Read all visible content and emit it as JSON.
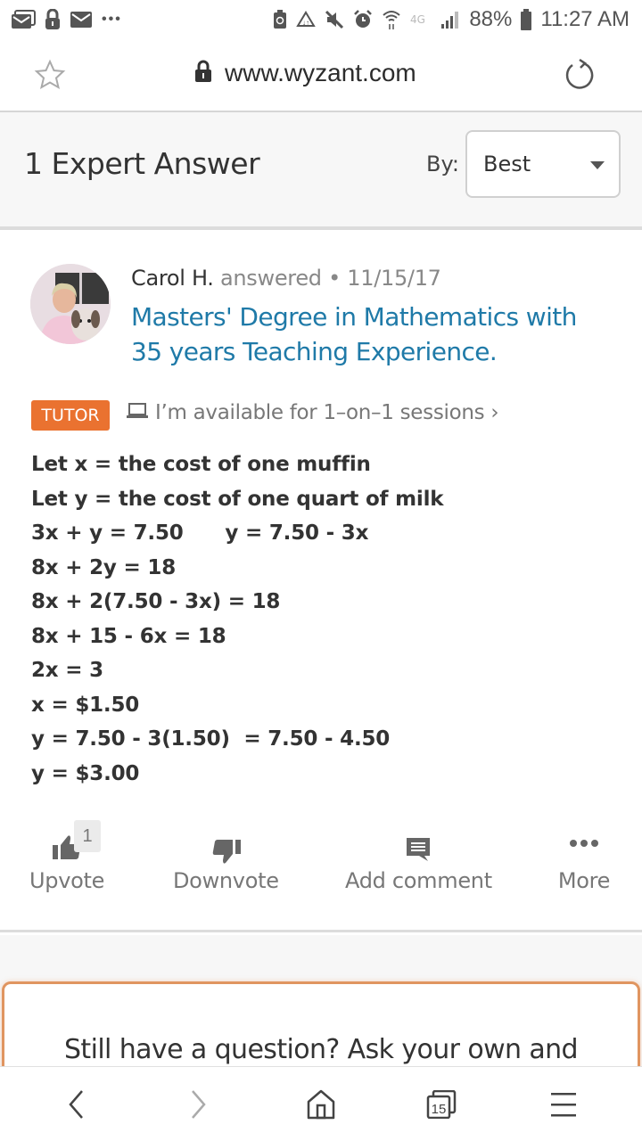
{
  "status_bar": {
    "left_icons": [
      "email-stack-icon",
      "lock-icon",
      "email-icon",
      "more-notifications-icon"
    ],
    "right_icons": [
      "battery-saver-icon",
      "recycle-icon",
      "mute-icon",
      "alarm-icon",
      "wifi-icon",
      "lte-icon",
      "signal-icon"
    ],
    "battery": "88%",
    "time": "11:27 AM"
  },
  "browser": {
    "url": "www.wyzant.com",
    "bookmark_icon": "star-icon",
    "secure_icon": "lock-icon",
    "reload_icon": "reload-icon"
  },
  "answers_header": {
    "title": "1 Expert Answer",
    "sort_label": "By:",
    "sort_value": "Best"
  },
  "answer": {
    "author": "Carol H.",
    "answered_text": "answered • 11/15/17",
    "tutor_title": "Masters' Degree in Mathematics with 35 years Teaching Experience.",
    "badge": "TUTOR",
    "availability": "I’m available for 1–on–1 sessions ›",
    "solution_lines": [
      "Let x = the cost of one muffin",
      "Let y = the cost of one quart of milk",
      "3x + y = 7.50      y = 7.50 - 3x",
      "8x + 2y = 18",
      "8x + 2(7.50 - 3x) = 18",
      "8x + 15 - 6x = 18",
      "2x = 3",
      "x = $1.50",
      "y = 7.50 - 3(1.50)  = 7.50 - 4.50",
      "y = $3.00"
    ],
    "actions": {
      "upvote": {
        "label": "Upvote",
        "count": "1"
      },
      "downvote": {
        "label": "Downvote"
      },
      "comment": {
        "label": "Add comment"
      },
      "more": {
        "label": "More"
      }
    }
  },
  "cta": {
    "text": "Still have a question? Ask your own and"
  },
  "navbar": {
    "tab_count": "15"
  },
  "colors": {
    "accent_orange": "#ea7230",
    "link_blue": "#1f7aa8",
    "text_dark": "#333333",
    "text_muted": "#777777"
  }
}
